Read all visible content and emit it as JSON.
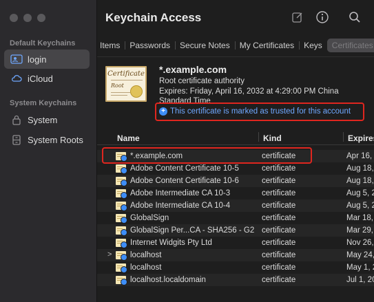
{
  "sidebar": {
    "default_title": "Default Keychains",
    "system_title": "System Keychains",
    "items": [
      {
        "label": "login",
        "icon": "person-lock-icon"
      },
      {
        "label": "iCloud",
        "icon": "cloud-icon"
      },
      {
        "label": "System",
        "icon": "lock-icon"
      },
      {
        "label": "System Roots",
        "icon": "cabinet-icon"
      }
    ]
  },
  "toolbar": {
    "title": "Keychain Access",
    "icons": [
      "compose-icon",
      "info-icon",
      "search-icon"
    ]
  },
  "tabs": [
    "Items",
    "Passwords",
    "Secure Notes",
    "My Certificates",
    "Keys",
    "Certificates"
  ],
  "detail": {
    "name": "*.example.com",
    "type": "Root certificate authority",
    "expires": "Expires: Friday, April 16, 2032 at 4:29:00 PM China",
    "expires_cont": "Standard Time",
    "trusted": "This certificate is marked as trusted for this account",
    "cert_image_title": "Certificate",
    "cert_image_sub": "Root"
  },
  "table": {
    "columns": [
      "Name",
      "Kind",
      "Expires"
    ],
    "rows": [
      {
        "name": "*.example.com",
        "kind": "certificate",
        "expires": "Apr 16,",
        "chevron": ""
      },
      {
        "name": "Adobe Content Certificate 10-5",
        "kind": "certificate",
        "expires": "Aug 18,",
        "chevron": ""
      },
      {
        "name": "Adobe Content Certificate 10-6",
        "kind": "certificate",
        "expires": "Aug 18,",
        "chevron": ""
      },
      {
        "name": "Adobe Intermediate CA 10-3",
        "kind": "certificate",
        "expires": "Aug 5, 2",
        "chevron": ""
      },
      {
        "name": "Adobe Intermediate CA 10-4",
        "kind": "certificate",
        "expires": "Aug 5, 2",
        "chevron": ""
      },
      {
        "name": "GlobalSign",
        "kind": "certificate",
        "expires": "Mar 18,",
        "chevron": ""
      },
      {
        "name": "GlobalSign Per...CA - SHA256 - G2",
        "kind": "certificate",
        "expires": "Mar 29,",
        "chevron": ""
      },
      {
        "name": "Internet Widgits Pty Ltd",
        "kind": "certificate",
        "expires": "Nov 26,",
        "chevron": ""
      },
      {
        "name": "localhost",
        "kind": "certificate",
        "expires": "May 24,",
        "chevron": ">"
      },
      {
        "name": "localhost",
        "kind": "certificate",
        "expires": "May 1, 2",
        "chevron": ""
      },
      {
        "name": "localhost.localdomain",
        "kind": "certificate",
        "expires": "Jul 1, 20",
        "chevron": ""
      }
    ]
  },
  "colors": {
    "accent": "#3e8ef7",
    "highlight_box": "#e0261f",
    "trusted_text": "#6fa8ff"
  }
}
